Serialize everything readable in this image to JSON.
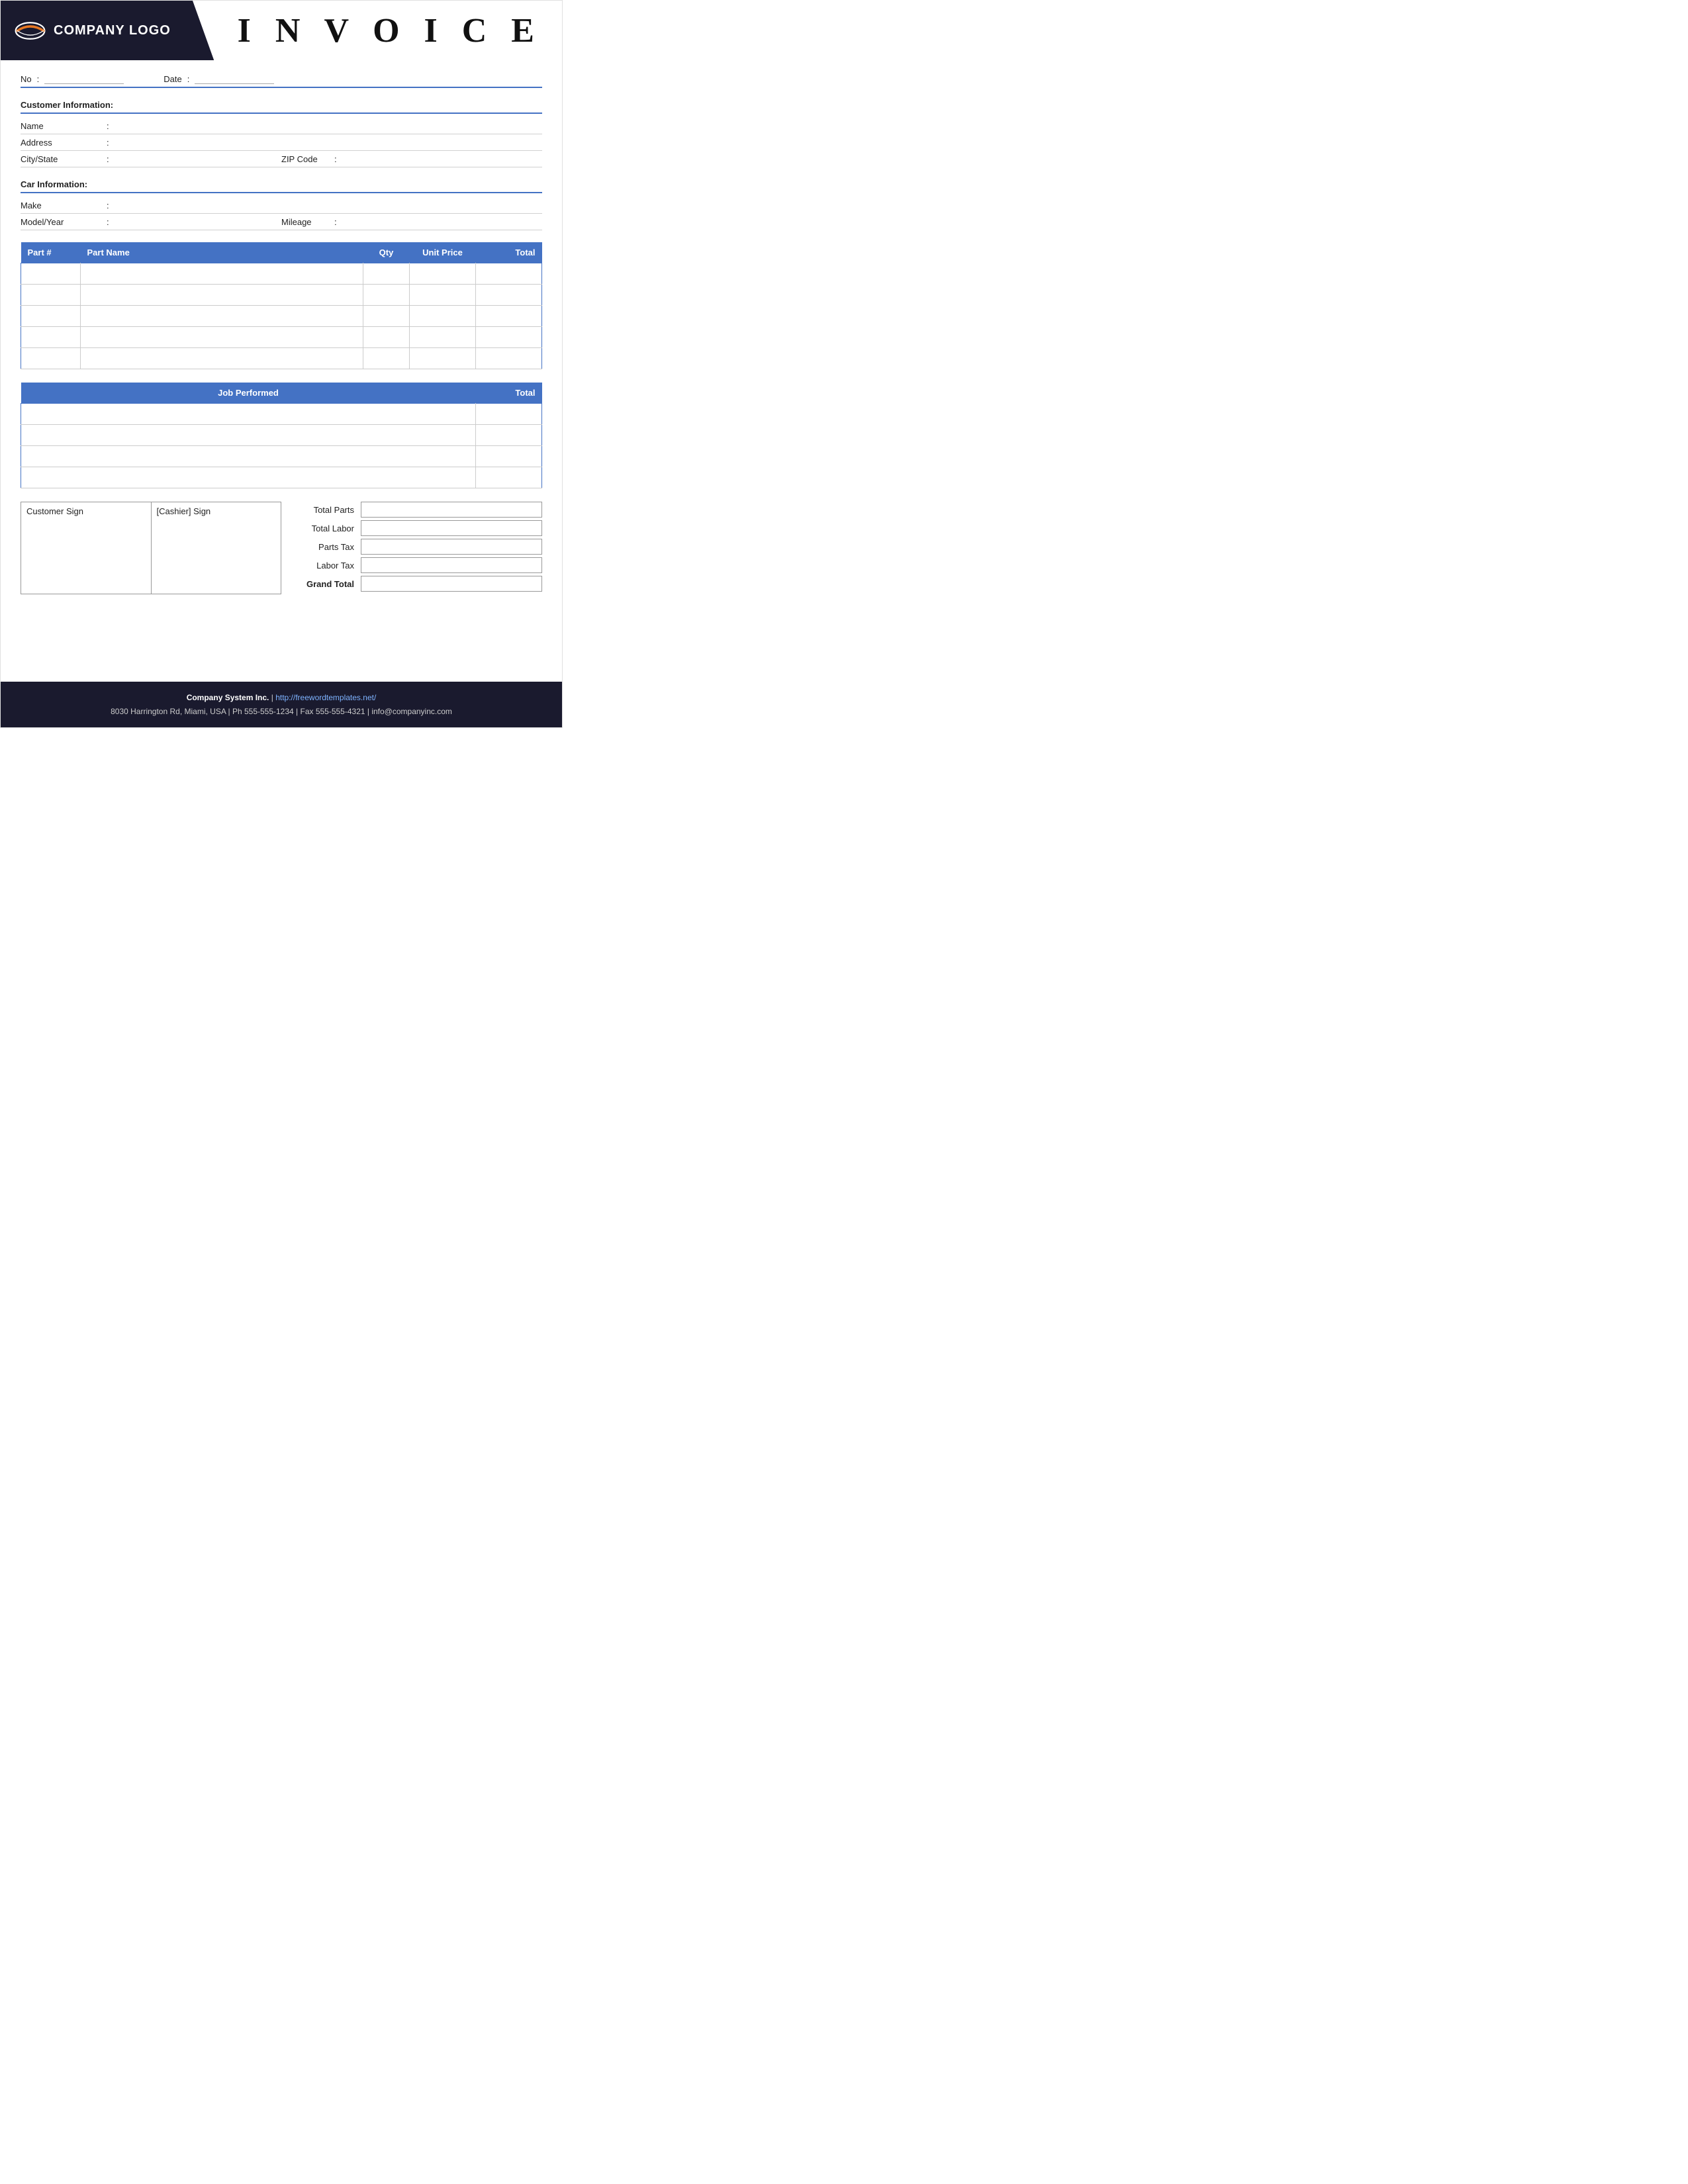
{
  "header": {
    "logo_text": "COMPANY LOGO",
    "invoice_title": "I N V O I C E"
  },
  "invoice_fields": {
    "no_label": "No",
    "no_colon": ":",
    "date_label": "Date",
    "date_colon": ":"
  },
  "customer_info": {
    "section_title": "Customer Information:",
    "name_label": "Name",
    "name_colon": ":",
    "address_label": "Address",
    "address_colon": ":",
    "city_state_label": "City/State",
    "city_state_colon": ":",
    "zip_code_label": "ZIP Code",
    "zip_code_colon": ":"
  },
  "car_info": {
    "section_title": "Car Information:",
    "make_label": "Make",
    "make_colon": ":",
    "model_year_label": "Model/Year",
    "model_year_colon": ":",
    "mileage_label": "Mileage",
    "mileage_colon": ":"
  },
  "parts_table": {
    "col_part_num": "Part #",
    "col_part_name": "Part Name",
    "col_qty": "Qty",
    "col_unit_price": "Unit Price",
    "col_total": "Total",
    "rows": [
      {
        "part_num": "",
        "part_name": "",
        "qty": "",
        "unit_price": "",
        "total": ""
      },
      {
        "part_num": "",
        "part_name": "",
        "qty": "",
        "unit_price": "",
        "total": ""
      },
      {
        "part_num": "",
        "part_name": "",
        "qty": "",
        "unit_price": "",
        "total": ""
      },
      {
        "part_num": "",
        "part_name": "",
        "qty": "",
        "unit_price": "",
        "total": ""
      },
      {
        "part_num": "",
        "part_name": "",
        "qty": "",
        "unit_price": "",
        "total": ""
      }
    ]
  },
  "job_table": {
    "col_job": "Job Performed",
    "col_total": "Total",
    "rows": [
      {
        "job": "",
        "total": ""
      },
      {
        "job": "",
        "total": ""
      },
      {
        "job": "",
        "total": ""
      },
      {
        "job": "",
        "total": ""
      }
    ]
  },
  "signatures": {
    "customer_sign_label": "Customer Sign",
    "cashier_sign_label": "[Cashier] Sign"
  },
  "totals": {
    "total_parts_label": "Total Parts",
    "total_labor_label": "Total Labor",
    "parts_tax_label": "Parts Tax",
    "labor_tax_label": "Labor Tax",
    "grand_total_label": "Grand Total"
  },
  "footer": {
    "company_name": "Company System Inc.",
    "separator": "|",
    "website_label": "http://freewordtemplates.net/",
    "address_line": "8030 Harrington Rd, Miami, USA | Ph 555-555-1234 | Fax 555-555-4321 | info@companyinc.com"
  }
}
